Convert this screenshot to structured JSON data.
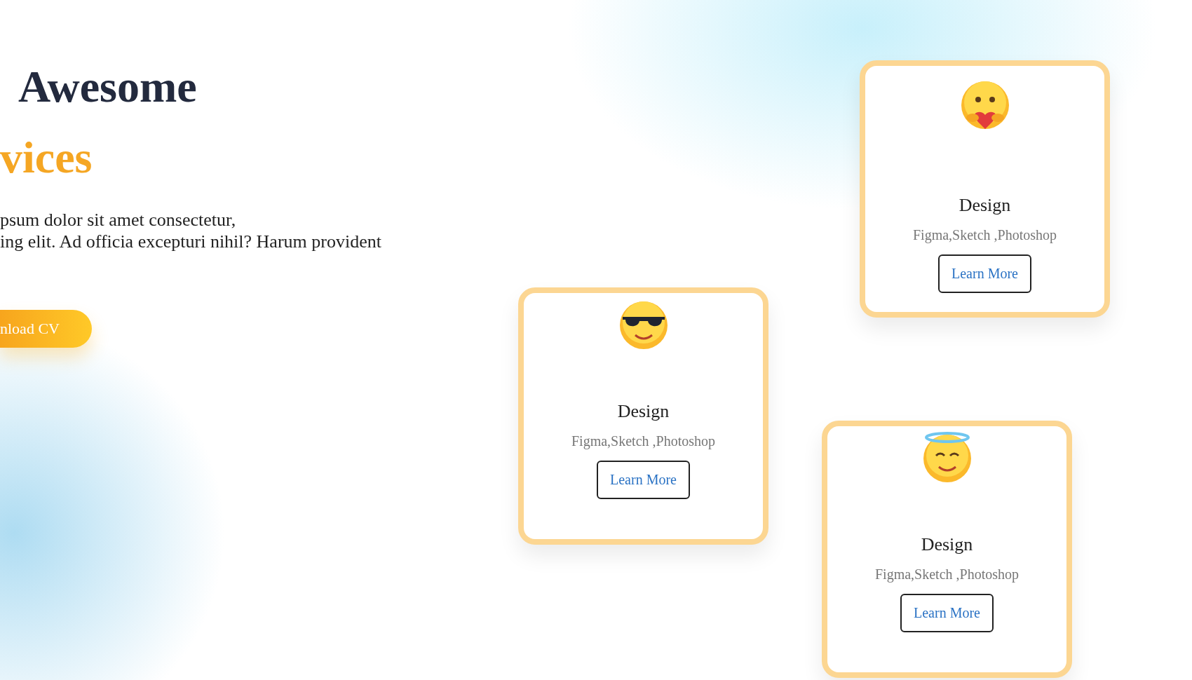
{
  "hero": {
    "heading": "Awesome",
    "heading_accent": "vices",
    "paragraph_lines": [
      "psum dolor sit amet consectetur,",
      "ing elit. Ad officia excepturi nihil? Harum provident"
    ],
    "button": "nload CV"
  },
  "cards": [
    {
      "kind": "hug",
      "title": "Design",
      "skills": "Figma,Sketch ,Photoshop",
      "button": "Learn More"
    },
    {
      "kind": "sunglasses",
      "title": "Design",
      "skills": "Figma,Sketch ,Photoshop",
      "button": "Learn More"
    },
    {
      "kind": "halo",
      "title": "Design",
      "skills": "Figma,Sketch ,Photoshop",
      "button": "Learn More"
    }
  ]
}
